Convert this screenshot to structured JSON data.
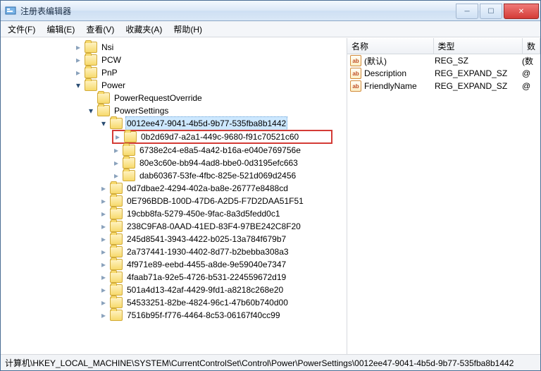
{
  "window": {
    "title": "注册表编辑器"
  },
  "menus": [
    "文件(F)",
    "编辑(E)",
    "查看(V)",
    "收藏夹(A)",
    "帮助(H)"
  ],
  "tree": {
    "top": [
      {
        "name": "Nsi",
        "expander": "right"
      },
      {
        "name": "PCW",
        "expander": "right"
      },
      {
        "name": "PnP",
        "expander": "right"
      }
    ],
    "power": {
      "label": "Power",
      "requestOverride": "PowerRequestOverride",
      "settings": {
        "label": "PowerSettings",
        "selected": {
          "label": "0012ee47-9041-4b5d-9b77-535fba8b1442",
          "highlighted": "0b2d69d7-a2a1-449c-9680-f91c70521c60",
          "rest": [
            "6738e2c4-e8a5-4a42-b16a-e040e769756e",
            "80e3c60e-bb94-4ad8-bbe0-0d3195efc663",
            "dab60367-53fe-4fbc-825e-521d069d2456"
          ]
        },
        "siblings": [
          "0d7dbae2-4294-402a-ba8e-26777e8488cd",
          "0E796BDB-100D-47D6-A2D5-F7D2DAA51F51",
          "19cbb8fa-5279-450e-9fac-8a3d5fedd0c1",
          "238C9FA8-0AAD-41ED-83F4-97BE242C8F20",
          "245d8541-3943-4422-b025-13a784f679b7",
          "2a737441-1930-4402-8d77-b2bebba308a3",
          "4f971e89-eebd-4455-a8de-9e59040e7347",
          "4faab71a-92e5-4726-b531-224559672d19",
          "501a4d13-42af-4429-9fd1-a8218c268e20",
          "54533251-82be-4824-96c1-47b60b740d00",
          "7516b95f-f776-4464-8c53-06167f40cc99"
        ]
      }
    }
  },
  "values": {
    "columns": [
      "名称",
      "类型",
      "数"
    ],
    "rows": [
      {
        "name": "(默认)",
        "type": "REG_SZ",
        "data": "(数"
      },
      {
        "name": "Description",
        "type": "REG_EXPAND_SZ",
        "data": "@"
      },
      {
        "name": "FriendlyName",
        "type": "REG_EXPAND_SZ",
        "data": "@"
      }
    ]
  },
  "status": "计算机\\HKEY_LOCAL_MACHINE\\SYSTEM\\CurrentControlSet\\Control\\Power\\PowerSettings\\0012ee47-9041-4b5d-9b77-535fba8b1442"
}
